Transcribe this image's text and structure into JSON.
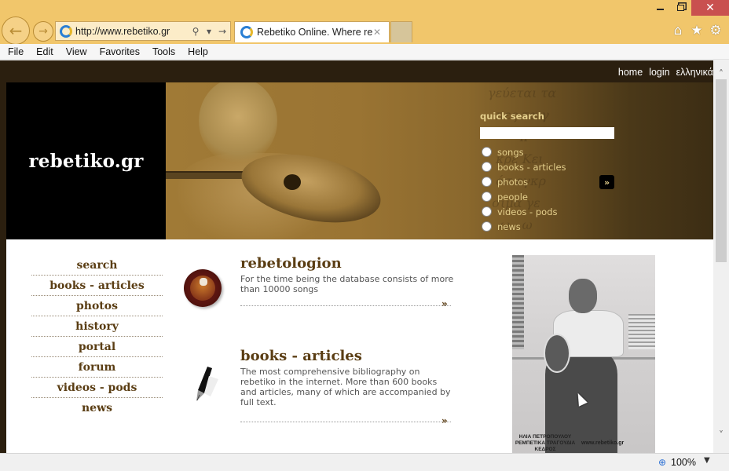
{
  "browser": {
    "window_controls": {
      "minimize": "—",
      "maximize": "❐",
      "close": "✕"
    },
    "nav": {
      "back_icon": "←",
      "forward_icon": "→"
    },
    "address_bar": {
      "url": "http://www.rebetiko.gr",
      "search_icon": "⚲",
      "dropdown_icon": "▾",
      "go_icon": "→"
    },
    "tab": {
      "title": "Rebetiko Online. Where reb...",
      "close_icon": "✕"
    },
    "toolbar_icons": {
      "home": "⌂",
      "favorites": "★",
      "settings": "⚙"
    },
    "menu": [
      "File",
      "Edit",
      "View",
      "Favorites",
      "Tools",
      "Help"
    ],
    "status": {
      "zoom_icon": "⊕",
      "zoom": "100%",
      "zoom_dropdown": "▼"
    },
    "scrollbar": {
      "up_icon": "˄",
      "down_icon": "˅"
    }
  },
  "site": {
    "top_links": [
      "home",
      "login",
      "ελληνικά"
    ],
    "logo": "rebetiko.gr",
    "banner_script": "γεύεται τα\n  πες τα γ\n        π\n  κρέ Κει\n  όσ εγκρ\n σίμα γε\n   ω   ω\n  ες  α   πε\n  ρις   ει",
    "quick_search": {
      "title": "quick search",
      "input_value": "",
      "options": [
        "songs",
        "books - articles",
        "photos",
        "people",
        "videos - pods",
        "news"
      ],
      "go_icon": "»"
    },
    "left_nav": [
      "search",
      "books - articles",
      "photos",
      "history",
      "portal",
      "forum",
      "videos - pods",
      "news"
    ],
    "features": [
      {
        "title": "rebetologion",
        "description": "For the time being the database consists of more than 10000 songs",
        "more_icon": "»"
      },
      {
        "title": "books - articles",
        "description": "The most comprehensive bibliography on rebetiko in the internet. More than 600 books and articles, many of which are accompanied by full text.",
        "more_icon": "»"
      }
    ],
    "photo": {
      "caption_left": "ΗΛΙΑ ΠΕΤΡΟΠΟΥΛΟΥ ΡΕΜΠΕΤΙΚΑ ΤΡΑΓΟΥΔΙΑ ΚΕΔΡΟΣ",
      "caption_right": "www.rebetiko.gr"
    }
  }
}
